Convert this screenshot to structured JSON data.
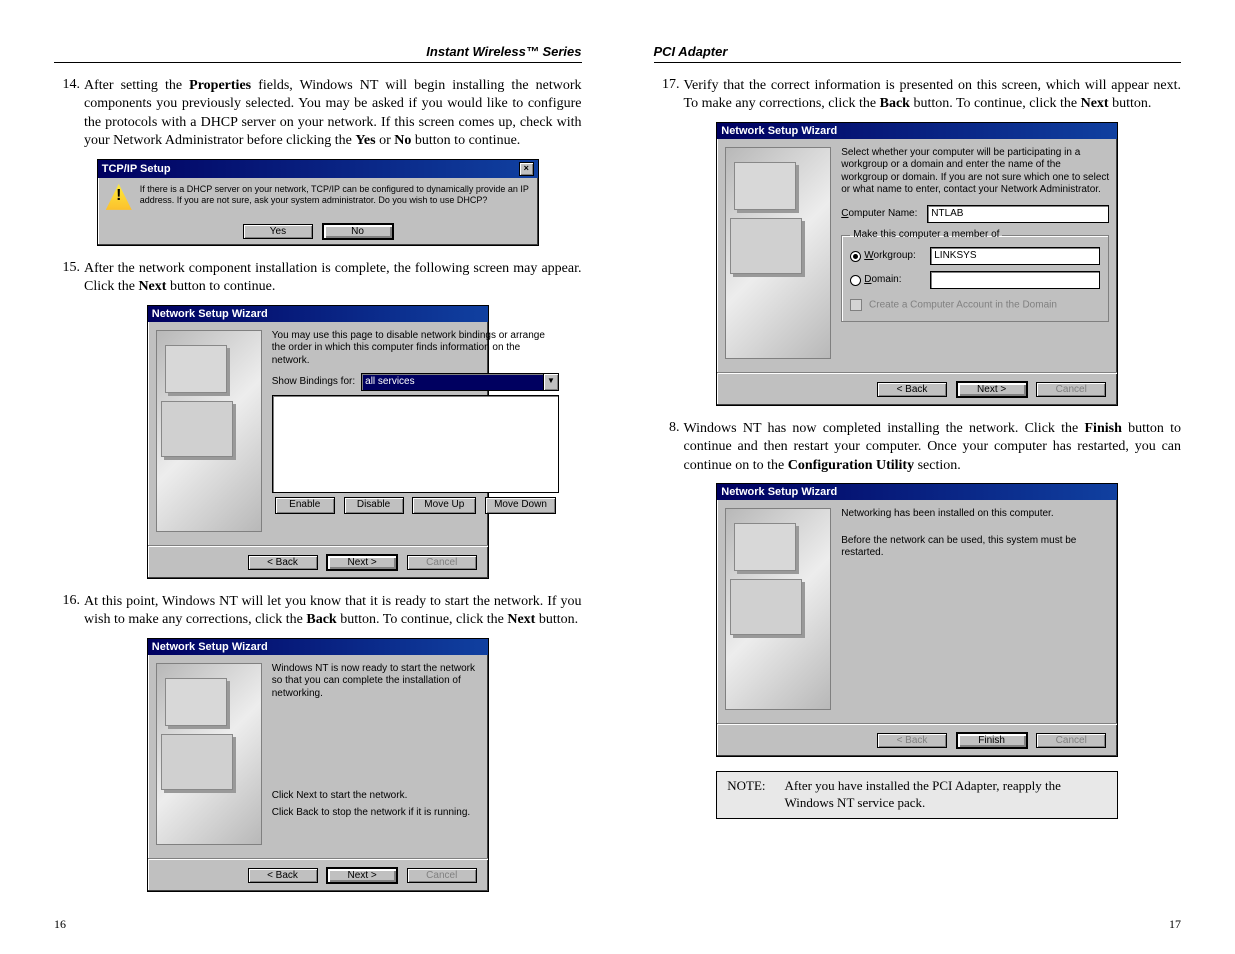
{
  "headers": {
    "left": "Instant Wireless™ Series",
    "right": "PCI Adapter"
  },
  "page_numbers": {
    "left": "16",
    "right": "17"
  },
  "steps": {
    "s14": {
      "num": "14.",
      "pre": "After setting the ",
      "b1": "Properties",
      "mid1": " fields, Windows NT will begin installing the network components you previously selected. You may be asked if you would like to configure the protocols with a DHCP server on your network. If this screen comes up, check with your Network Administrator before clicking the ",
      "b2": "Yes",
      "mid2": " or ",
      "b3": "No",
      "post": " button to continue."
    },
    "s15": {
      "num": "15.",
      "pre": "After the network component installation is complete, the following screen may appear. Click the ",
      "b1": "Next",
      "post": " button to continue."
    },
    "s16": {
      "num": "16.",
      "pre": "At this point, Windows NT will let you know that it is ready to start the network. If you wish to make any corrections, click the ",
      "b1": "Back",
      "mid1": " button. To continue, click the ",
      "b2": "Next",
      "post": " button."
    },
    "s17": {
      "num": "17.",
      "pre": "Verify that the correct information is presented on this screen, which will appear next. To make any corrections, click the ",
      "b1": "Back",
      "mid1": " button. To continue, click the ",
      "b2": "Next",
      "post": " button."
    },
    "s8": {
      "num": "8.",
      "pre": "Windows NT has now completed installing the network. Click the ",
      "b1": "Finish",
      "mid1": " button to continue and then restart your computer. Once your computer has restarted, you can continue on to the ",
      "b2": "Configuration Utility",
      "post": " section."
    }
  },
  "tcpip": {
    "title": "TCP/IP Setup",
    "msg": "If there is a DHCP server on your network, TCP/IP can be configured to dynamically provide an IP address. If you are not sure, ask your system administrator. Do you wish to use DHCP?",
    "yes": "Yes",
    "no": "No"
  },
  "wizard": {
    "title": "Network Setup Wizard",
    "back": "< Back",
    "next": "Next >",
    "cancel": "Cancel",
    "finish": "Finish"
  },
  "bindings": {
    "intro": "You may use this page to disable network bindings or arrange the order in which this computer finds information on the network.",
    "show_label": "Show Bindings for:",
    "show_value": "all services",
    "enable": "Enable",
    "disable": "Disable",
    "moveup": "Move Up",
    "movedown": "Move Down"
  },
  "ready": {
    "line1": "Windows NT is now ready to start the network so that you can complete the installation of networking.",
    "line2": "Click Next to start the network.",
    "line3": "Click Back to stop the network if it is running."
  },
  "membership": {
    "intro": "Select whether your computer will be participating in a workgroup or a domain and enter the name of the workgroup or domain. If you are not sure which one to select or what name to enter, contact your Network Administrator.",
    "cn_label": "Computer Name:",
    "cn_value": "NTLAB",
    "group_title": "Make this computer a member of",
    "workgroup": "Workgroup:",
    "workgroup_value": "LINKSYS",
    "domain": "Domain:",
    "create_acct": "Create a Computer Account in the Domain"
  },
  "installed": {
    "line1": "Networking has been installed on this computer.",
    "line2": "Before the network can be used, this system must be restarted."
  },
  "note": {
    "label": "NOTE:",
    "text": "After you have installed the PCI Adapter, reapply the Windows NT service pack."
  }
}
